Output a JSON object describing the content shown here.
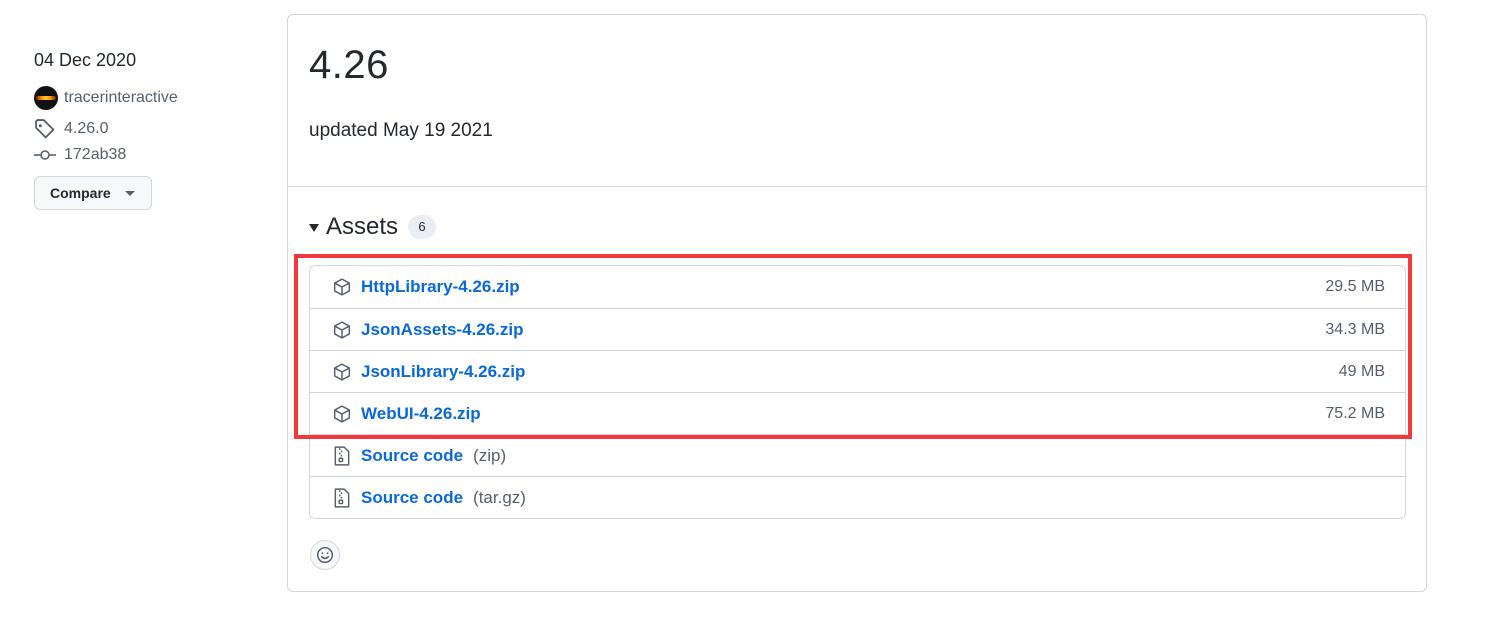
{
  "meta": {
    "date": "04 Dec 2020",
    "author": "tracerinteractive",
    "tag": "4.26.0",
    "commit": "172ab38",
    "compare_label": "Compare"
  },
  "release": {
    "title": "4.26",
    "updated": "updated May 19 2021"
  },
  "assets": {
    "title": "Assets",
    "count": "6",
    "files": [
      {
        "name": "HttpLibrary-4.26.zip",
        "size": "29.5 MB"
      },
      {
        "name": "JsonAssets-4.26.zip",
        "size": "34.3 MB"
      },
      {
        "name": "JsonLibrary-4.26.zip",
        "size": "49 MB"
      },
      {
        "name": "WebUI-4.26.zip",
        "size": "75.2 MB"
      }
    ],
    "source": [
      {
        "label": "Source code",
        "format": "(zip)"
      },
      {
        "label": "Source code",
        "format": "(tar.gz)"
      }
    ]
  },
  "colors": {
    "link": "#0969da",
    "highlight": "#f0393b",
    "muted": "#57606a"
  },
  "icons": {
    "tag": "tag-icon",
    "commit": "commit-icon",
    "package": "package-icon",
    "file-zip": "file-zip-icon",
    "smiley": "smiley-icon"
  }
}
